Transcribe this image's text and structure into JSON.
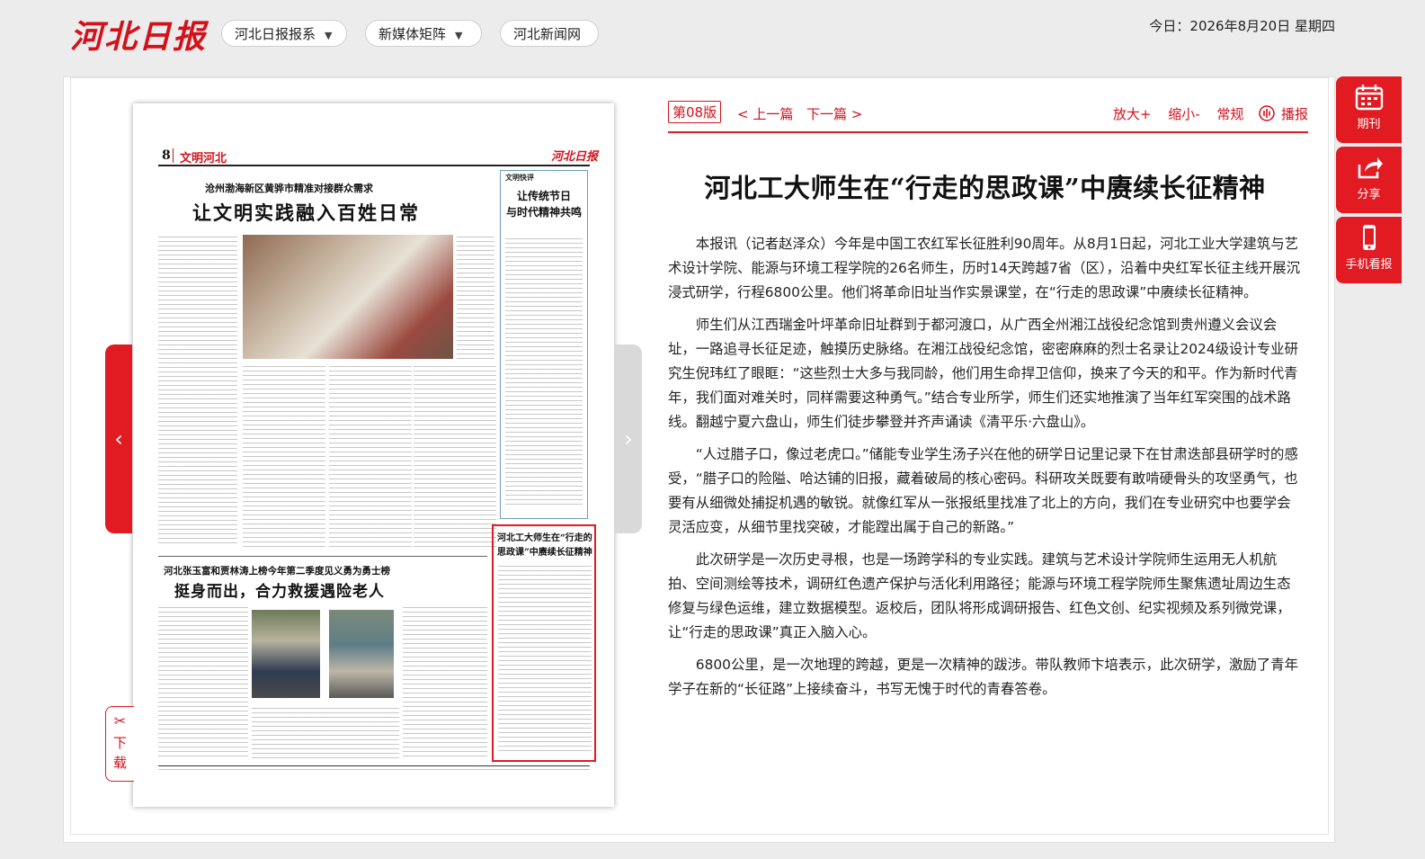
{
  "header": {
    "logo_text": "河北日报",
    "menus": [
      {
        "label": "河北日报报系",
        "has_caret": true
      },
      {
        "label": "新媒体矩阵",
        "has_caret": true
      },
      {
        "label": "河北新闻网",
        "has_caret": false
      }
    ],
    "today": "今日：2026年8月20日 星期四"
  },
  "newspaper": {
    "page_number": "8",
    "section": "文明河北",
    "masthead_small": "河北日报",
    "headline1_kicker": "沧州渤海新区黄骅市精准对接群众需求",
    "headline1": "让文明实践融入百姓日常",
    "sidebar_tag": "文明快评",
    "sidebar_title": "让传统节日\n与时代精神共鸣",
    "highlight_title": "河北工大师生在“行走的\n思政课”中赓续长征精神",
    "headline2_kicker": "河北张玉富和贾林涛上榜今年第二季度见义勇为勇士榜",
    "headline2": "挺身而出，合力救援遇险老人"
  },
  "pager": {
    "prev_icon": "chevron-left",
    "next_icon": "chevron-right"
  },
  "download": {
    "label_1": "下",
    "label_2": "载"
  },
  "right_tools": [
    {
      "label": "期刊",
      "icon": "calendar-icon"
    },
    {
      "label": "分享",
      "icon": "share-icon"
    },
    {
      "label": "手机看报",
      "icon": "phone-icon"
    }
  ],
  "article": {
    "edition": "第08版",
    "prev": "< 上一篇",
    "next": "下一篇 >",
    "zoom_in": "放大+",
    "zoom_out": "缩小-",
    "normal": "常规",
    "play": "播报",
    "title": "河北工大师生在“行走的思政课”中赓续长征精神",
    "paragraphs": [
      "本报讯（记者赵泽众）今年是中国工农红军长征胜利90周年。从8月1日起，河北工业大学建筑与艺术设计学院、能源与环境工程学院的26名师生，历时14天跨越7省（区），沿着中央红军长征主线开展沉浸式研学，行程6800公里。他们将革命旧址当作实景课堂，在“行走的思政课”中赓续长征精神。",
      "师生们从江西瑞金叶坪革命旧址群到于都河渡口，从广西全州湘江战役纪念馆到贵州遵义会议会址，一路追寻长征足迹，触摸历史脉络。在湘江战役纪念馆，密密麻麻的烈士名录让2024级设计专业研究生倪玮红了眼眶：“这些烈士大多与我同龄，他们用生命捍卫信仰，换来了今天的和平。作为新时代青年，我们面对难关时，同样需要这种勇气。”结合专业所学，师生们还实地推演了当年红军突围的战术路线。翻越宁夏六盘山，师生们徒步攀登并齐声诵读《清平乐·六盘山》。",
      "“人过腊子口，像过老虎口。”储能专业学生汤子兴在他的研学日记里记录下在甘肃迭部县研学时的感受，“腊子口的险隘、哈达铺的旧报，藏着破局的核心密码。科研攻关既要有敢啃硬骨头的攻坚勇气，也要有从细微处捕捉机遇的敏锐。就像红军从一张报纸里找准了北上的方向，我们在专业研究中也要学会灵活应变，从细节里找突破，才能蹚出属于自己的新路。”",
      "此次研学是一次历史寻根，也是一场跨学科的专业实践。建筑与艺术设计学院师生运用无人机航拍、空间测绘等技术，调研红色遗产保护与活化利用路径；能源与环境工程学院师生聚焦遗址周边生态修复与绿色运维，建立数据模型。返校后，团队将形成调研报告、红色文创、纪实视频及系列微党课，让“行走的思政课”真正入脑入心。",
      "6800公里，是一次地理的跨越，更是一次精神的跋涉。带队教师卞培表示，此次研学，激励了青年学子在新的“长征路”上接续奋斗，书写无愧于时代的青春答卷。"
    ]
  },
  "colors": {
    "accent": "#e21a22",
    "brand": "#d3111b"
  }
}
